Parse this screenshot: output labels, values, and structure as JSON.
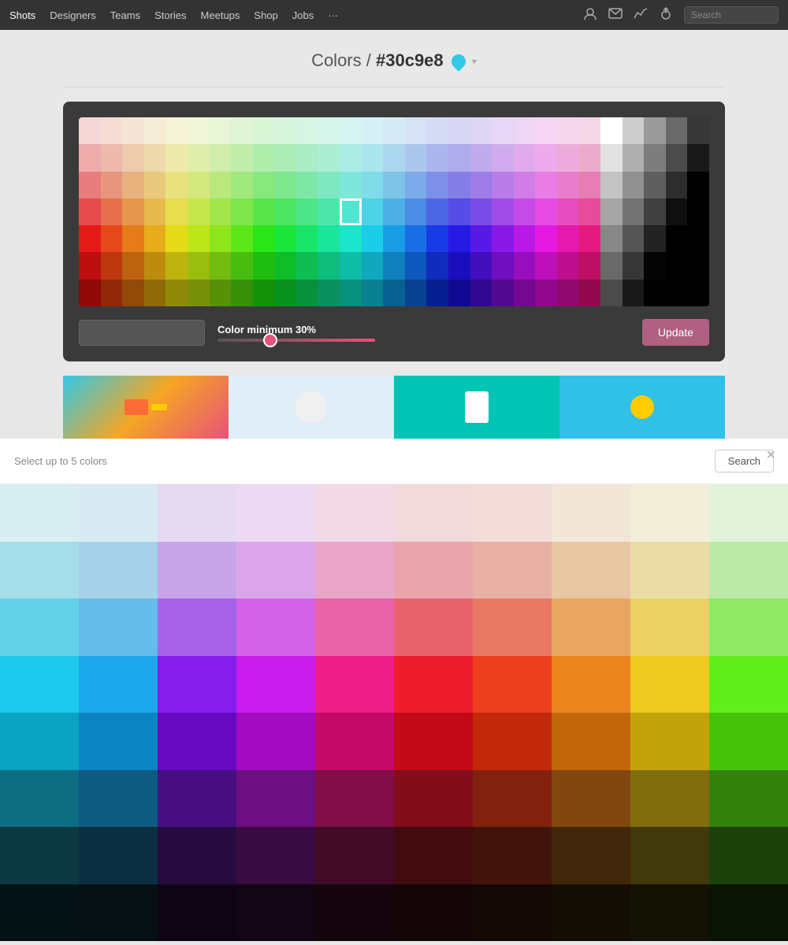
{
  "navbar": {
    "links": [
      {
        "label": "Shots",
        "active": true
      },
      {
        "label": "Designers",
        "active": false
      },
      {
        "label": "Teams",
        "active": false
      },
      {
        "label": "Stories",
        "active": false
      },
      {
        "label": "Meetups",
        "active": false
      },
      {
        "label": "Shop",
        "active": false
      },
      {
        "label": "Jobs",
        "active": false
      },
      {
        "label": "···",
        "active": false
      }
    ],
    "search_placeholder": "Search"
  },
  "page": {
    "breadcrumb_part1": "Colors",
    "separator": "/",
    "color_value": "#30c9e8"
  },
  "picker": {
    "hex_value": "#30c9e8",
    "color_min_label": "Color minimum",
    "color_min_percent": "30%",
    "update_button": "Update"
  },
  "modal": {
    "hint": "Select up to 5 colors",
    "search_button": "Search",
    "close_label": "×"
  }
}
